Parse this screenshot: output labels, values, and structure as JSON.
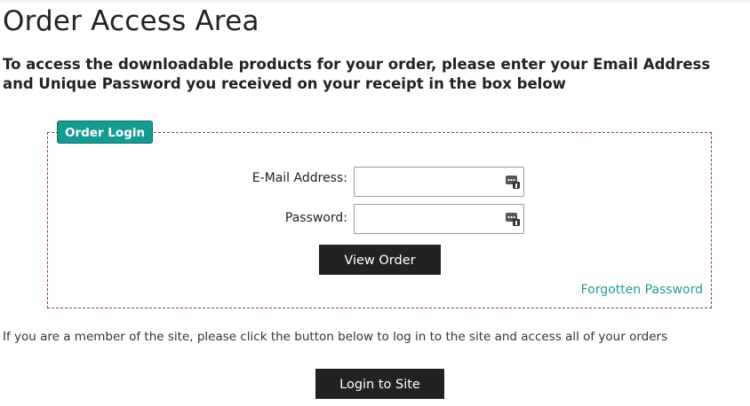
{
  "page": {
    "title": "Order Access Area",
    "intro": "To access the downloadable products for your order, please enter your Email Address and Unique Password you received on your receipt in the box below"
  },
  "order_login": {
    "legend": "Order Login",
    "email_label": "E-Mail Address:",
    "email_value": "",
    "password_label": "Password:",
    "password_value": "",
    "field_icon": "password-manager-key-icon",
    "submit_label": "View Order",
    "forgot_link": "Forgotten Password"
  },
  "member": {
    "text": "If you are a member of the site, please click the button below to log in to the site and access all of your orders",
    "login_label": "Login to Site"
  },
  "colors": {
    "accent_teal": "#129a93",
    "link_teal": "#2a9a92",
    "button_dark": "#222222",
    "border_purple": "#8a3a6e"
  }
}
